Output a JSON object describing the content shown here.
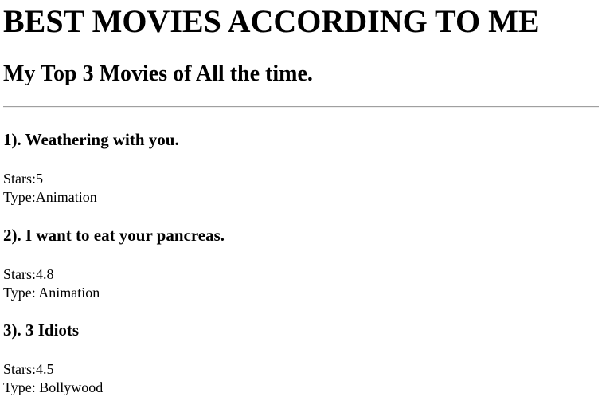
{
  "title": "BEST MOVIES ACCORDING TO ME",
  "subtitle": "My Top 3 Movies of All the time.",
  "movies": [
    {
      "heading": "1). Weathering with you.",
      "stars": "Stars:5",
      "type": "Type:Animation"
    },
    {
      "heading": "2). I want to eat your pancreas.",
      "stars": "Stars:4.8",
      "type": "Type: Animation"
    },
    {
      "heading": "3). 3 Idiots",
      "stars": "Stars:4.5",
      "type": "Type: Bollywood"
    }
  ]
}
